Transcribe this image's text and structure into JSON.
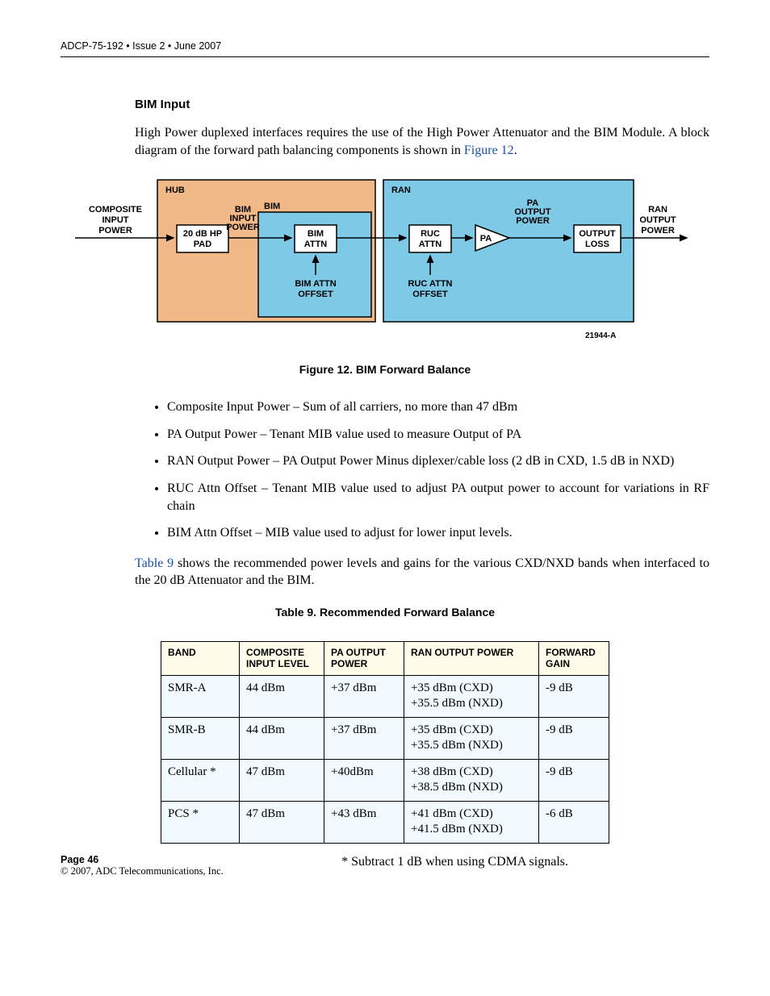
{
  "header": "ADCP-75-192 • Issue 2 • June 2007",
  "section_title": "BIM Input",
  "intro_before": "High Power duplexed interfaces requires the use of the High Power Attenuator and the BIM Module. A block diagram of the forward path balancing components is shown in ",
  "intro_link": "Figure 12",
  "intro_after": ".",
  "diagram": {
    "hub": "HUB",
    "bim_group": "BIM",
    "ran": "RAN",
    "composite": "COMPOSITE",
    "input": "INPUT",
    "power": "POWER",
    "pad1": "20 dB HP",
    "pad2": "PAD",
    "bim_input1": "BIM",
    "bim_input2": "INPUT",
    "bim_input3": "POWER",
    "bim_attn1": "BIM",
    "bim_attn2": "ATTN",
    "bim_offset1": "BIM ATTN",
    "bim_offset2": "OFFSET",
    "ruc_attn1": "RUC",
    "ruc_attn2": "ATTN",
    "ruc_offset1": "RUC ATTN",
    "ruc_offset2": "OFFSET",
    "pa": "PA",
    "pa_out1": "PA",
    "pa_out2": "OUTPUT",
    "pa_out3": "POWER",
    "out_loss1": "OUTPUT",
    "out_loss2": "LOSS",
    "ran_out1": "RAN",
    "ran_out2": "OUTPUT",
    "ran_out3": "POWER",
    "fig_id": "21944-A"
  },
  "fig_caption": "Figure 12. BIM Forward Balance",
  "bullets": [
    "Composite Input Power – Sum of all carriers, no more than 47 dBm",
    "PA Output Power – Tenant MIB value used to measure Output of PA",
    "RAN Output Power – PA Output Power Minus diplexer/cable loss (2 dB in CXD, 1.5 dB in NXD)",
    "RUC Attn Offset – Tenant MIB value used to adjust PA output power to account for variations in RF chain",
    "BIM Attn Offset – MIB value used to adjust for lower input levels."
  ],
  "para2_link": "Table 9",
  "para2_after": " shows the recommended power levels and gains for the various CXD/NXD bands when interfaced to the 20 dB Attenuator and the BIM.",
  "table_caption": "Table 9. Recommended Forward Balance",
  "table": {
    "headers": [
      "BAND",
      "COMPOSITE INPUT LEVEL",
      "PA OUTPUT POWER",
      "RAN OUTPUT POWER",
      "FORWARD GAIN"
    ],
    "rows": [
      [
        "SMR-A",
        "44 dBm",
        "+37 dBm",
        "+35 dBm (CXD)\n+35.5 dBm (NXD)",
        "-9 dB"
      ],
      [
        "SMR-B",
        "44 dBm",
        "+37 dBm",
        "+35 dBm (CXD)\n+35.5 dBm (NXD)",
        "-9 dB"
      ],
      [
        "Cellular *",
        "47 dBm",
        "+40dBm",
        "+38 dBm (CXD)\n+38.5 dBm (NXD)",
        "-9 dB"
      ],
      [
        "PCS *",
        "47 dBm",
        "+43 dBm",
        "+41 dBm (CXD)\n+41.5 dBm (NXD)",
        "-6 dB"
      ]
    ]
  },
  "table_footnote": "* Subtract 1 dB when using CDMA signals.",
  "footer_page": "Page 46",
  "footer_copy": "© 2007, ADC Telecommunications, Inc."
}
